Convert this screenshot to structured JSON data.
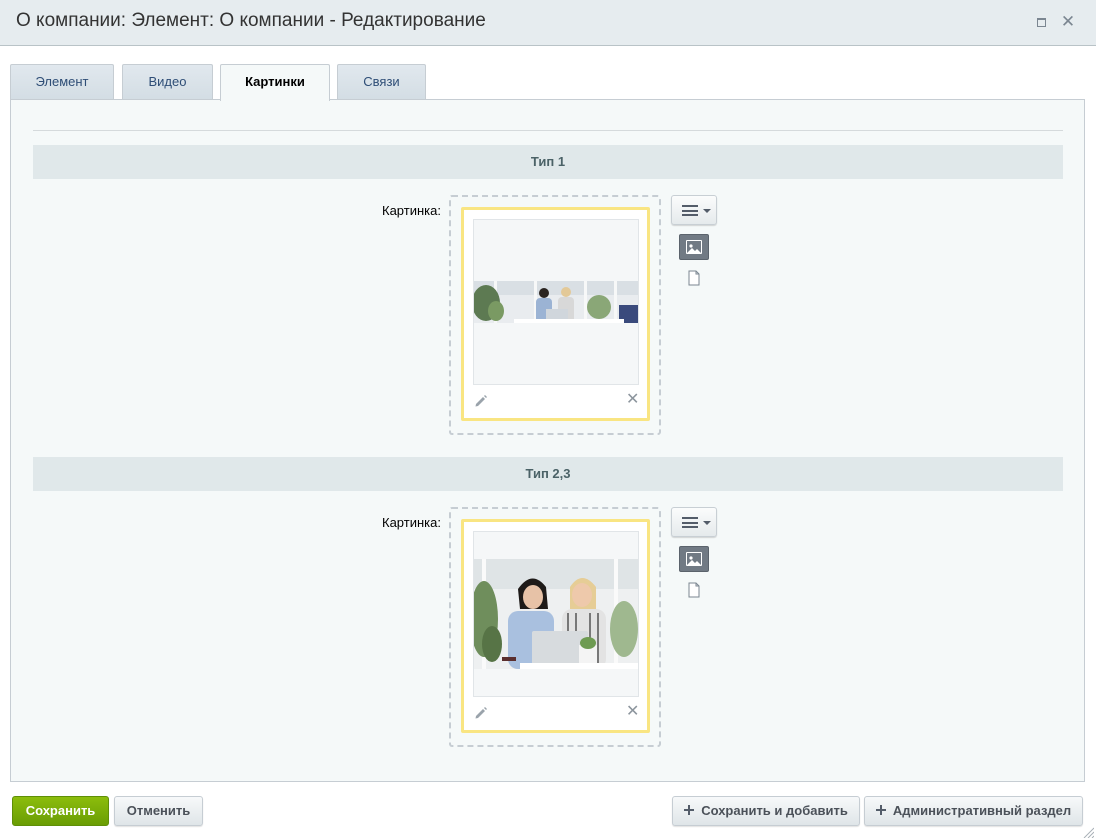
{
  "window": {
    "title": "О компании: Элемент: О компании - Редактирование"
  },
  "tabs": [
    {
      "label": "Элемент",
      "active": false
    },
    {
      "label": "Видео",
      "active": false
    },
    {
      "label": "Картинки",
      "active": true
    },
    {
      "label": "Связи",
      "active": false
    }
  ],
  "sections": [
    {
      "title": "Тип 1",
      "field_label": "Картинка:"
    },
    {
      "title": "Тип 2,3",
      "field_label": "Картинка:"
    }
  ],
  "footer": {
    "save_label": "Сохранить",
    "cancel_label": "Отменить",
    "save_add_label": "Сохранить и добавить",
    "admin_label": "Административный раздел"
  },
  "colors": {
    "accent_green": "#7bad08",
    "file_border": "#f9e582",
    "tab_text": "#2e4d76"
  },
  "icons": [
    "maximize-icon",
    "close-icon",
    "menu-icon",
    "image-icon",
    "document-icon",
    "pencil-icon",
    "remove-icon",
    "plus-icon"
  ]
}
